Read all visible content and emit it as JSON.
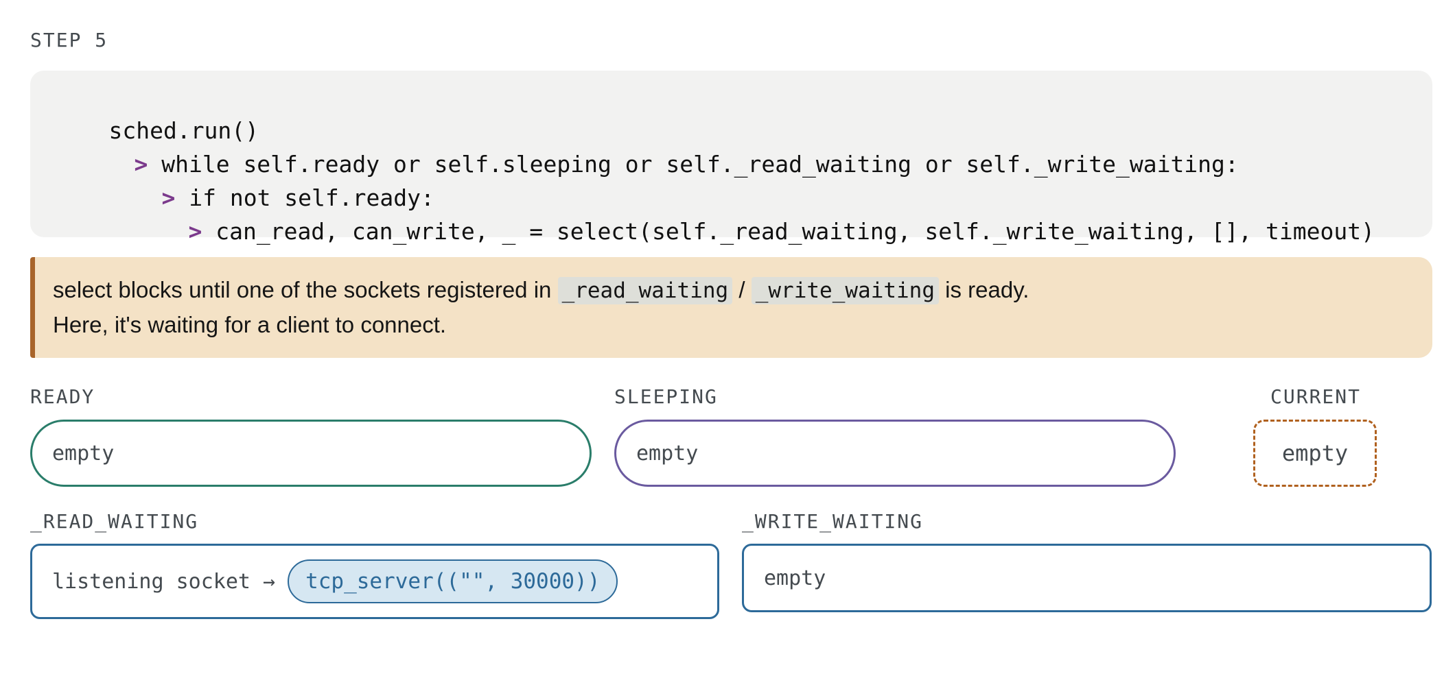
{
  "step": {
    "label": "STEP 5"
  },
  "code": {
    "lines": [
      {
        "arrow": "",
        "text": "sched.run()"
      },
      {
        "arrow": ">",
        "text": "while self.ready or self.sleeping or self._read_waiting or self._write_waiting:"
      },
      {
        "arrow": ">",
        "text": "if not self.ready:"
      },
      {
        "arrow": ">",
        "text": "can_read, can_write, _ = select(self._read_waiting, self._write_waiting, [], timeout)"
      }
    ]
  },
  "note": {
    "line1_before": "select blocks until one of the sockets registered in ",
    "chip1": "_read_waiting",
    "separator": " / ",
    "chip2": "_write_waiting",
    "line1_after": " is ready.",
    "line2": "Here, it's waiting for a client to connect."
  },
  "queues": {
    "ready": {
      "label": "READY",
      "content": "empty"
    },
    "sleeping": {
      "label": "SLEEPING",
      "content": "empty"
    },
    "current": {
      "label": "CURRENT",
      "content": "empty"
    },
    "read_waiting": {
      "label": "_READ_WAITING",
      "socket_label": "listening socket →",
      "task": "tcp_server((\"\", 30000))"
    },
    "write_waiting": {
      "label": "_WRITE_WAITING",
      "content": "empty"
    }
  },
  "colors": {
    "ready_border": "#2a7d6a",
    "sleeping_border": "#6a5a9f",
    "current_border": "#b0611f",
    "waiting_border": "#2d6a99",
    "arrow": "#7b3a8c",
    "note_bg": "#f4e2c6",
    "note_accent": "#a8642a",
    "code_bg": "#f2f2f1"
  }
}
